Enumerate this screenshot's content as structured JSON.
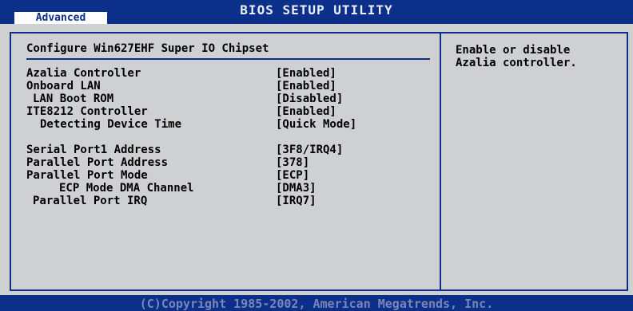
{
  "header": {
    "title": "BIOS SETUP UTILITY",
    "active_tab": "Advanced"
  },
  "page": {
    "heading": "Configure Win627EHF Super IO Chipset"
  },
  "settings": [
    {
      "label": "Azalia Controller",
      "value": "[Enabled]"
    },
    {
      "label": "Onboard LAN",
      "value": "[Enabled]"
    },
    {
      "label": "LAN Boot ROM",
      "value": "[Disabled]"
    },
    {
      "label": "ITE8212 Controller",
      "value": "[Enabled]"
    },
    {
      "label": "Detecting Device Time",
      "value": "[Quick Mode]"
    },
    {
      "label": "Serial Port1 Address",
      "value": "[3F8/IRQ4]"
    },
    {
      "label": "Parallel Port Address",
      "value": "[378]"
    },
    {
      "label": "Parallel Port Mode",
      "value": "[ECP]"
    },
    {
      "label": "ECP Mode DMA Channel",
      "value": "[DMA3]"
    },
    {
      "label": "Parallel Port IRQ",
      "value": "[IRQ7]"
    }
  ],
  "help": {
    "text": "Enable or disable Azalia controller."
  },
  "footer": {
    "copyright": "(C)Copyright 1985-2002, American Megatrends, Inc."
  }
}
